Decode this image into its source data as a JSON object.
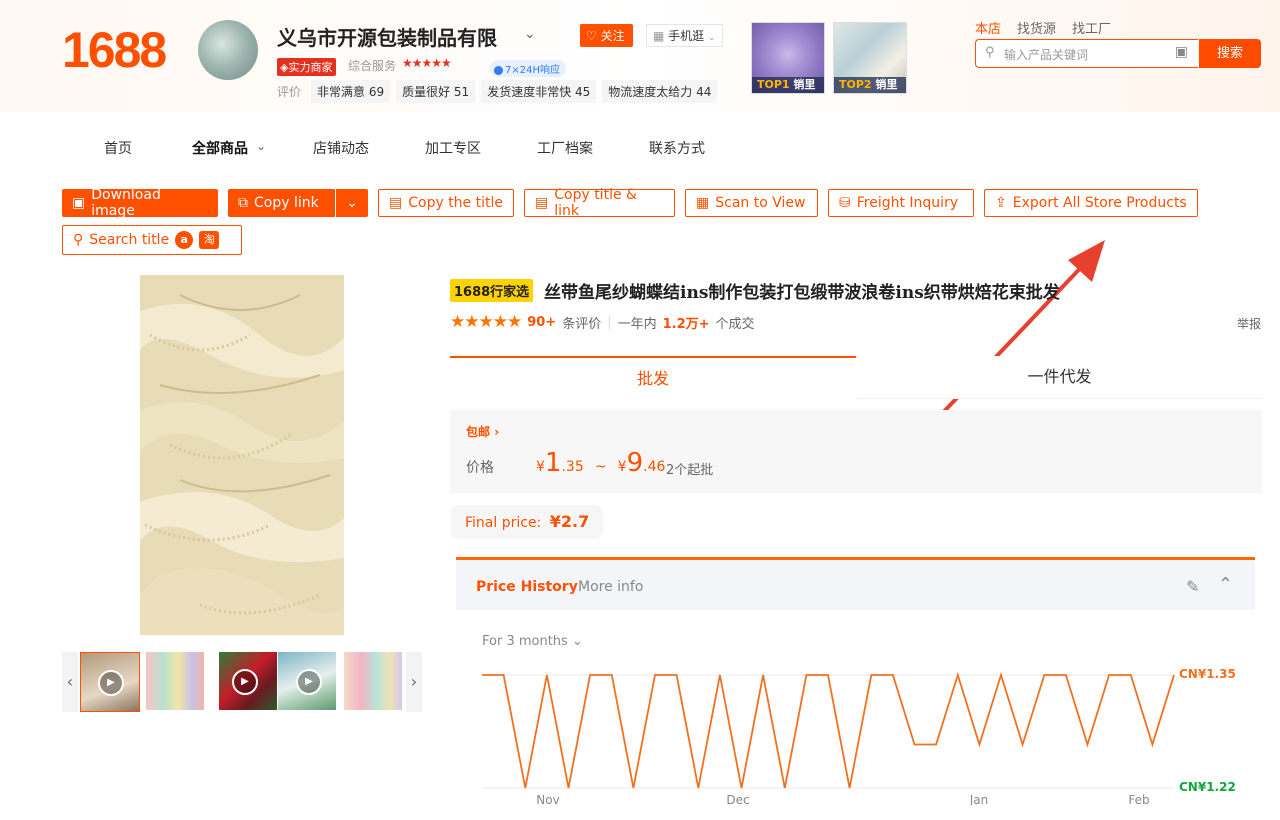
{
  "header": {
    "logo": "1688",
    "shop_name": "义乌市开源包装制品有限",
    "strength_badge": "实力商家",
    "service_label": "综合服务",
    "service_stars": "★★★★★",
    "response_badge": "7×24H响应",
    "eval_label": "评价",
    "eval_chips": [
      "非常满意 69",
      "质量很好 51",
      "发货速度非常快 45",
      "物流速度太给力 44"
    ],
    "follow_label": "关注",
    "mobile_label": "手机逛",
    "top_products": [
      {
        "rank": "TOP1",
        "suffix": "销里"
      },
      {
        "rank": "TOP2",
        "suffix": "销里"
      }
    ],
    "search_tabs": [
      "本店",
      "找货源",
      "找工厂"
    ],
    "search_placeholder": "输入产品关键词",
    "search_button": "搜索"
  },
  "nav": {
    "items": [
      "首页",
      "全部商品",
      "店铺动态",
      "加工专区",
      "工厂档案",
      "联系方式"
    ]
  },
  "toolbar": {
    "download_image": "Download image",
    "copy_link": "Copy link",
    "copy_title": "Copy the title",
    "copy_title_link": "Copy title & link",
    "scan_to_view": "Scan to View",
    "freight_inquiry": "Freight Inquiry",
    "export_products": "Export All Store Products",
    "search_title": "Search title",
    "taobao_icon_text": "淘"
  },
  "product": {
    "tag": "1688行家选",
    "title": "丝带鱼尾纱蝴蝶结ins制作包装打包缎带波浪卷ins织带烘焙花束批发",
    "stars": "★★★★★",
    "review_count": "90+",
    "review_suffix": "条评价",
    "year_label": "一年内",
    "sales": "1.2万+",
    "sales_suffix": "个成交",
    "report": "举报",
    "tabs": [
      "批发",
      "一件代发"
    ],
    "free_shipping": "包邮",
    "price_label": "价格",
    "price_low_int": "1",
    "price_low_dec": ".35",
    "price_high_int": "9",
    "price_high_dec": ".46",
    "currency": "¥",
    "range_sep": "~",
    "moq": "2个起批",
    "final_price_label": "Final price:",
    "final_price_value": "¥2.7"
  },
  "price_history": {
    "tab_active": "Price History",
    "tab_other": "More info",
    "range_select": "For 3 months",
    "max_label": "CN¥1.35",
    "min_label": "CN¥1.22"
  },
  "chart_data": {
    "type": "line",
    "title": "",
    "xlabel": "",
    "ylabel": "",
    "x_ticks": [
      "Nov",
      "Dec",
      "Jan",
      "Feb"
    ],
    "ylim": [
      1.22,
      1.35
    ],
    "series": [
      {
        "values": [
          1.35,
          1.35,
          1.22,
          1.35,
          1.22,
          1.35,
          1.35,
          1.22,
          1.35,
          1.35,
          1.22,
          1.35,
          1.22,
          1.35,
          1.22,
          1.35,
          1.35,
          1.22,
          1.35,
          1.35,
          1.27,
          1.27,
          1.35,
          1.27,
          1.35,
          1.27,
          1.35,
          1.35,
          1.27,
          1.35,
          1.35,
          1.27,
          1.35
        ]
      }
    ]
  },
  "colors": {
    "accent": "#ff5000",
    "chart_line": "#f07020",
    "price_low_label": "#12a53a"
  }
}
